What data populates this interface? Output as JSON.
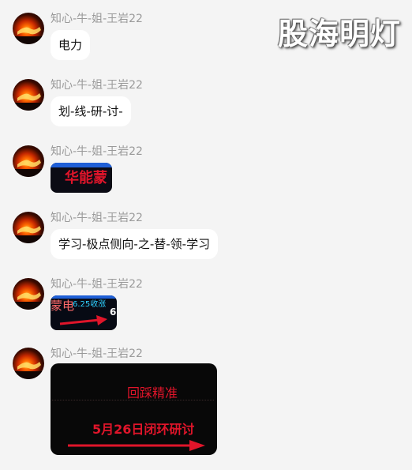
{
  "watermark": "股海明灯",
  "sender_name": "知心-牛-姐-王岩22",
  "messages": [
    {
      "type": "text",
      "text": "电力"
    },
    {
      "type": "text",
      "text": "划-线-研-讨-"
    },
    {
      "type": "image",
      "image_text": "华能蒙"
    },
    {
      "type": "text",
      "text": "学习-极点侧向-之-替-领-学习"
    },
    {
      "type": "image",
      "image_text": "蒙电",
      "image_subtext": "6.25收涨",
      "image_digit": "6"
    },
    {
      "type": "image",
      "line1": "回踩精准",
      "line2": "5月26日闭环研讨"
    }
  ],
  "colors": {
    "background": "#f4f4f4",
    "bubble": "#ffffff",
    "sender": "#9a9a9a",
    "image_red": "#e0152a",
    "image_cyan": "#2fd0ff",
    "image_blue_bar": "#1f5fd6"
  }
}
